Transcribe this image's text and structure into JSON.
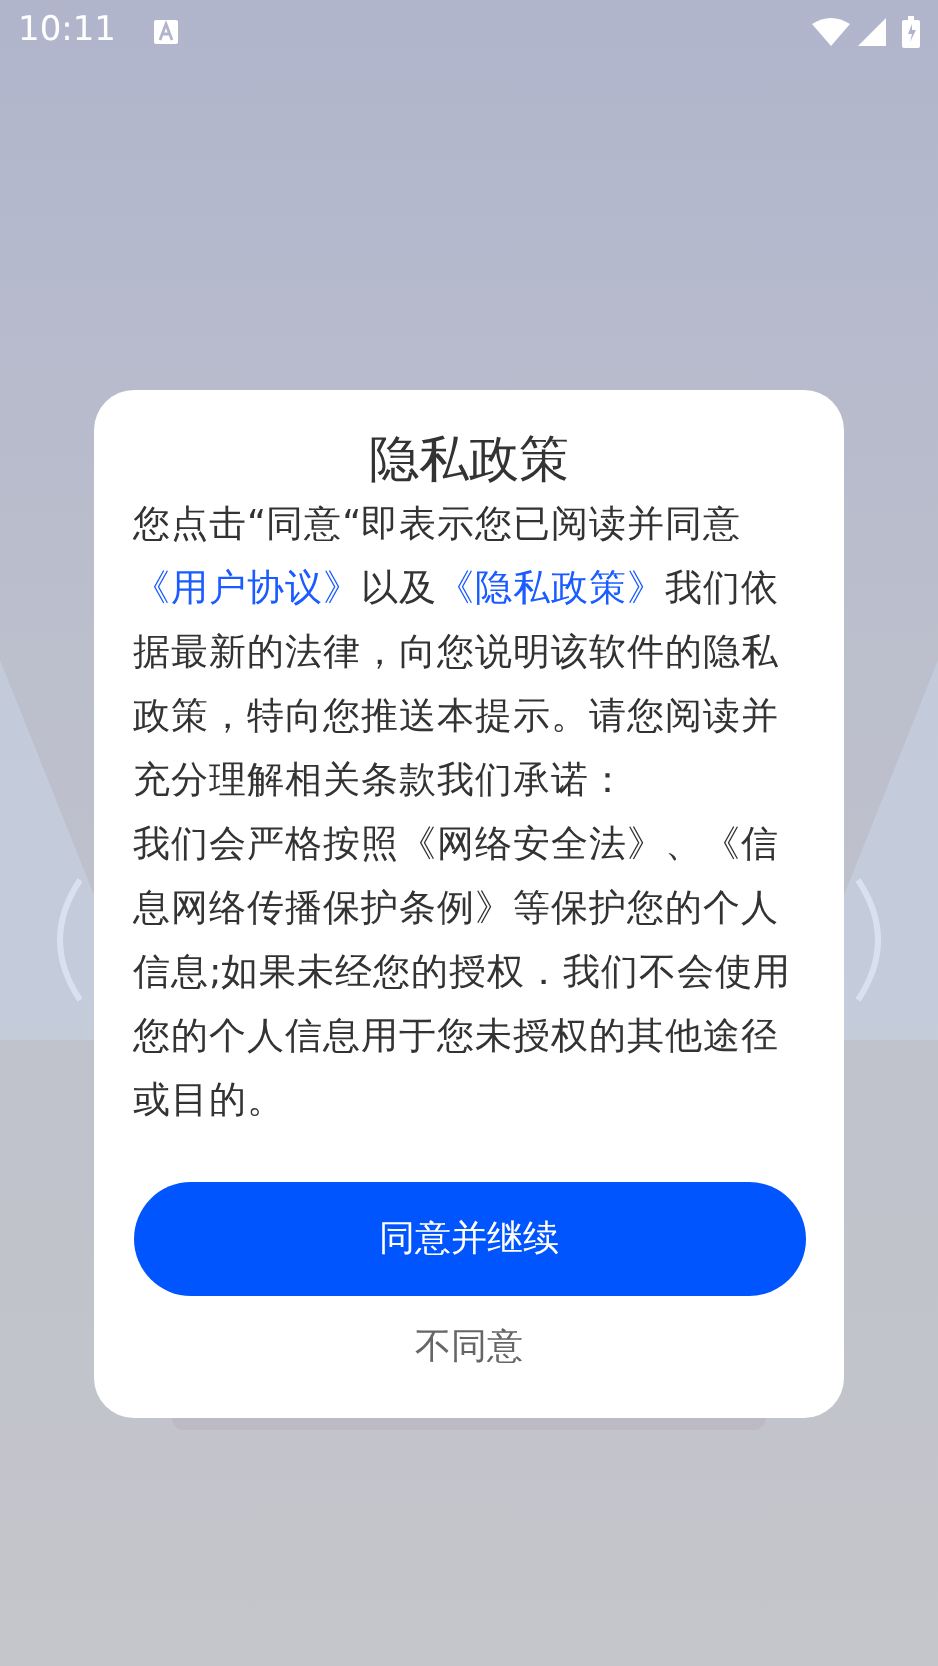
{
  "status_bar": {
    "time": "10:11"
  },
  "dialog": {
    "title": "隐私政策",
    "paragraphs": [
      [
        {
          "kind": "text",
          "text": "您点击“同意“即表示您已阅读并同意 "
        },
        {
          "kind": "link",
          "text": "《用户协议》"
        },
        {
          "kind": "text",
          "text": "以及"
        },
        {
          "kind": "link",
          "text": "《隐私政策》"
        },
        {
          "kind": "text",
          "text": "我们依据最新的法律，向您说明该软件的隐私政策，特向您推送本提示。请您阅读并充分理解相关条款我们承诺："
        }
      ],
      [
        {
          "kind": "text",
          "text": "我们会严格按照《网络安全法》、《信息网络传播保护条例》等保护您的个人信息;如果未经您的授权．我们不会使用您的个人信息用于您未授权的其他途径或目的。"
        }
      ]
    ],
    "buttons": [
      {
        "kind": "primary",
        "label": "同意并继续"
      },
      {
        "kind": "plain",
        "label": "不同意"
      }
    ]
  }
}
